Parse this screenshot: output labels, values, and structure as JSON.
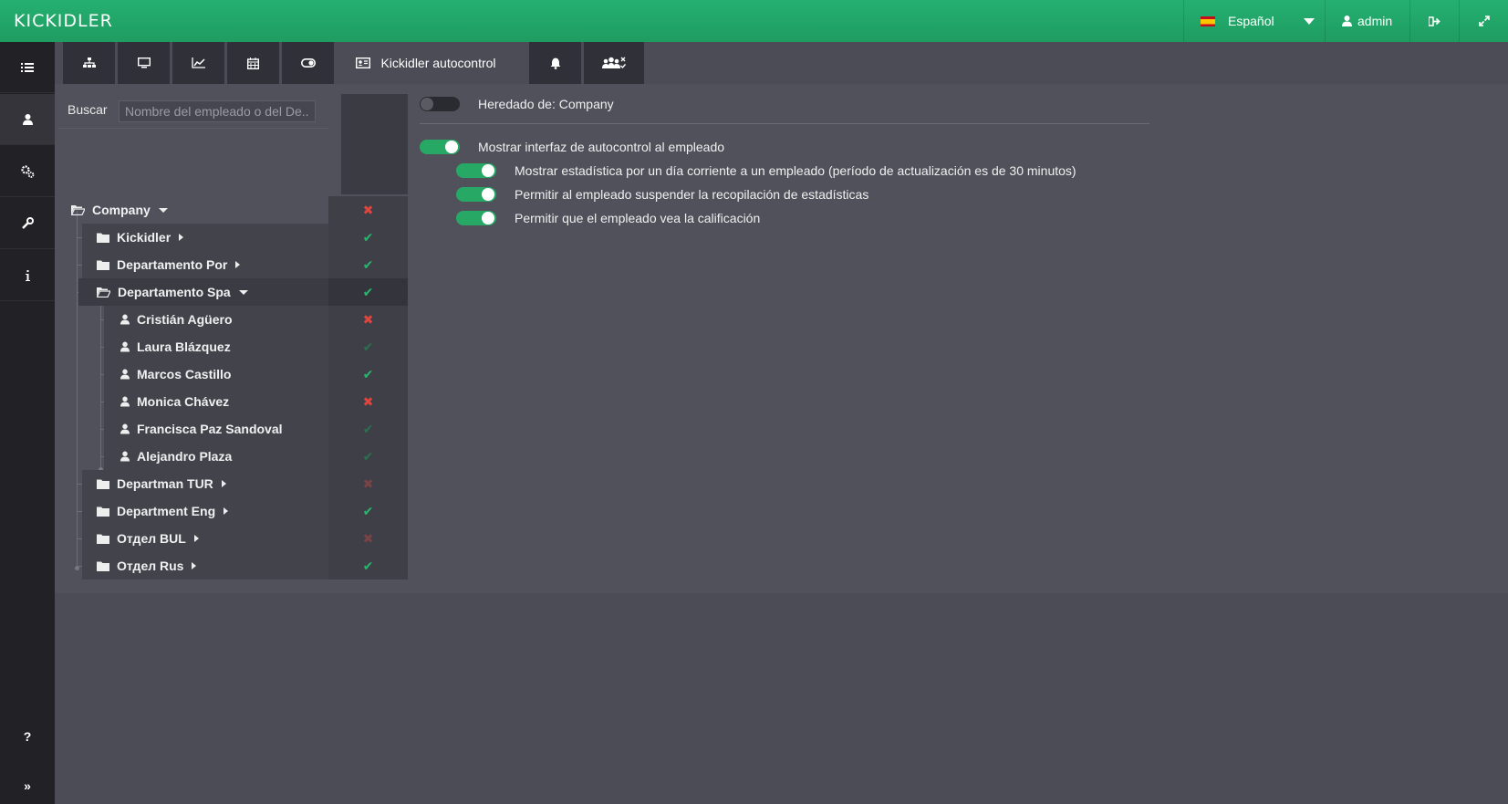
{
  "app": {
    "logo": "KICKIDLER"
  },
  "topbar": {
    "language": "Español",
    "user": "admin"
  },
  "leftnav": {
    "items": [
      {
        "icon": "list-icon"
      },
      {
        "icon": "user-icon"
      },
      {
        "icon": "gears-icon"
      },
      {
        "icon": "wrench-icon"
      },
      {
        "icon": "info-icon"
      }
    ],
    "help": "?",
    "expand": "»"
  },
  "tabs": [
    {
      "icon": "sitemap-icon"
    },
    {
      "icon": "desktop-icon"
    },
    {
      "icon": "chart-line-icon"
    },
    {
      "icon": "calendar-icon"
    },
    {
      "icon": "toggle-icon"
    },
    {
      "icon": "id-card-icon",
      "label": "Kickidler autocontrol",
      "active": true
    },
    {
      "icon": "bell-icon"
    },
    {
      "icon": "users-check-icon"
    }
  ],
  "search": {
    "label": "Buscar",
    "placeholder": "Nombre del empleado o del De..."
  },
  "tree": {
    "company": {
      "name": "Company",
      "status": "cross"
    },
    "groups": [
      {
        "name": "Kickidler",
        "status": "check"
      },
      {
        "name": "Departamento Por",
        "status": "check"
      },
      {
        "name": "Departamento Spa",
        "status": "check",
        "expanded": true,
        "employees": [
          {
            "name": "Cristián Agüero",
            "status": "cross"
          },
          {
            "name": "Laura Blázquez",
            "status": "check-faded"
          },
          {
            "name": "Marcos Castillo",
            "status": "check"
          },
          {
            "name": "Monica Chávez",
            "status": "cross"
          },
          {
            "name": "Francisca Paz Sandoval",
            "status": "check-faded"
          },
          {
            "name": "Alejandro Plaza",
            "status": "check-faded"
          }
        ]
      },
      {
        "name": "Departman TUR",
        "status": "cross-faded"
      },
      {
        "name": "Department Eng",
        "status": "check"
      },
      {
        "name": "Отдел BUL",
        "status": "cross-faded"
      },
      {
        "name": "Отдел Rus",
        "status": "check"
      }
    ]
  },
  "settings": {
    "inherited": {
      "label": "Heredado de: Company",
      "on": false
    },
    "main": {
      "label": "Mostrar interfaz de autocontrol al empleado",
      "on": true
    },
    "sub": [
      {
        "label": "Mostrar estadística por un día corriente a un empleado (período de actualización es de 30 minutos)",
        "on": true
      },
      {
        "label": "Permitir al empleado suspender la recopilación de estadísticas",
        "on": true
      },
      {
        "label": "Permitir que el empleado vea la calificación",
        "on": true
      }
    ]
  },
  "colors": {
    "green": "#27a865",
    "red": "#e0443f",
    "topbar": "#22a868"
  }
}
